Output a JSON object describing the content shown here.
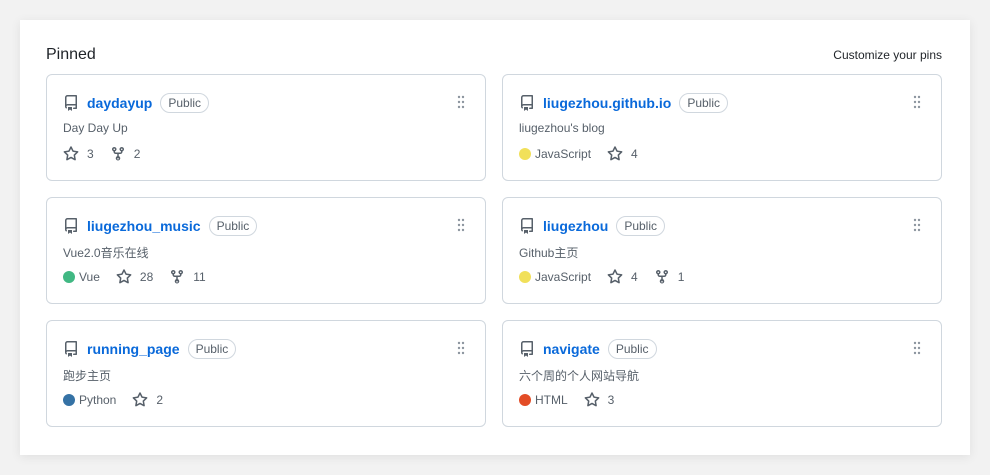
{
  "section": {
    "title": "Pinned",
    "customize_label": "Customize your pins"
  },
  "repos": [
    {
      "name": "daydayup",
      "badge": "Public",
      "description": "Day Day Up",
      "language": "",
      "language_color": "",
      "stars": "3",
      "forks": "2"
    },
    {
      "name": "liugezhou.github.io",
      "badge": "Public",
      "description": "liugezhou's blog",
      "language": "JavaScript",
      "language_color": "#f1e05a",
      "stars": "4",
      "forks": ""
    },
    {
      "name": "liugezhou_music",
      "badge": "Public",
      "description": "Vue2.0音乐在线",
      "language": "Vue",
      "language_color": "#41b883",
      "stars": "28",
      "forks": "11"
    },
    {
      "name": "liugezhou",
      "badge": "Public",
      "description": "Github主页",
      "language": "JavaScript",
      "language_color": "#f1e05a",
      "stars": "4",
      "forks": "1"
    },
    {
      "name": "running_page",
      "badge": "Public",
      "description": "跑步主页",
      "language": "Python",
      "language_color": "#3572A5",
      "stars": "2",
      "forks": ""
    },
    {
      "name": "navigate",
      "badge": "Public",
      "description": "六个周的个人网站导航",
      "language": "HTML",
      "language_color": "#e34c26",
      "stars": "3",
      "forks": ""
    }
  ],
  "icons": {
    "repo": "repo-icon",
    "star": "star-icon",
    "fork": "fork-icon",
    "drag": "grabber-icon"
  }
}
